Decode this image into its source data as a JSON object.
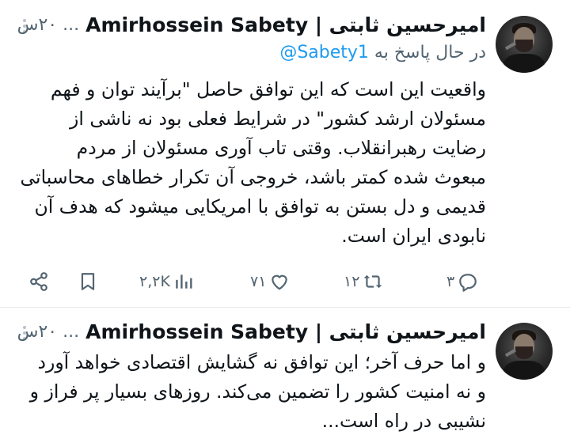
{
  "tweets": [
    {
      "author": "امیرحسین ثابتی | Amirhossein Sabety",
      "time": "... ۲۰س",
      "replying_to_prefix": "در حال پاسخ به",
      "replying_to_handle": "@Sabety1",
      "lines": [
        "واقعیت این است که این توافق حاصل \"برآیند توان و فهم",
        "مسئولان ارشد کشور\" در شرایط فعلی بود نه ناشی از",
        "رضایت رهبرانقلاب. وقتی تاب آوری مسئولان از مردم",
        "مبعوث شده کمتر باشد، خروجی آن تکرار خطاهای محاسباتی",
        "قدیمی و دل بستن به توافق با امریکایی میشود که هدف آن",
        "نابودی ایران است."
      ],
      "actions": {
        "replies": "۳",
        "retweets": "۱۲",
        "likes": "۷۱",
        "views": "۲,۲K"
      }
    },
    {
      "author": "امیرحسین ثابتی | Amirhossein Sabety",
      "time": "... ۲۰س",
      "lines": [
        "و اما حرف آخر؛ این توافق نه گشایش اقتصادی خواهد آورد",
        "و نه امنیت کشور را تضمین می‌کند. روزهای بسیار پر فراز و",
        "نشیبی در راه است..."
      ]
    }
  ],
  "colors": {
    "text": "#0f1419",
    "secondary": "#536471",
    "link": "#1d9bf0"
  },
  "icons": [
    "more-dots-icon",
    "reply-icon",
    "retweet-icon",
    "like-icon",
    "views-icon",
    "bookmark-icon",
    "share-icon",
    "avatar"
  ]
}
